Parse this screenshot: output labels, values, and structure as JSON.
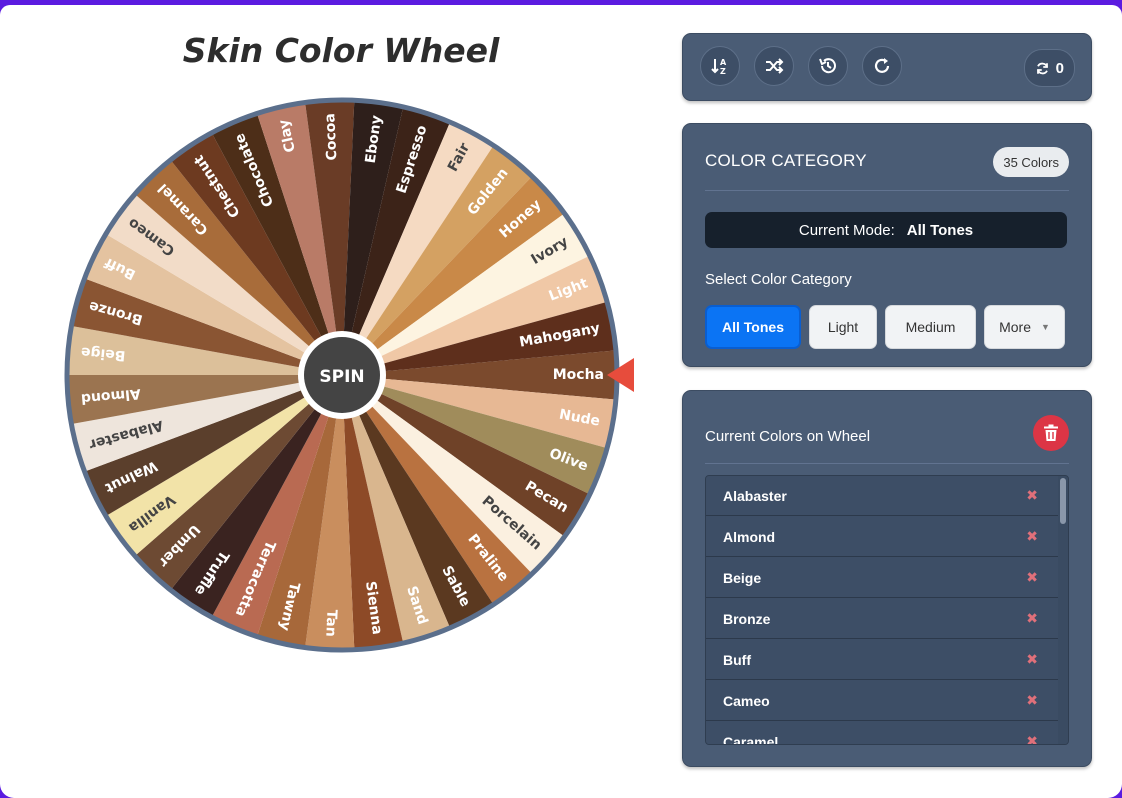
{
  "title": "Skin Color Wheel",
  "spin_label": "SPIN",
  "wheel": {
    "segments": [
      {
        "name": "Mocha",
        "color": "#7b4a2d"
      },
      {
        "name": "Nude",
        "color": "#e7b894"
      },
      {
        "name": "Olive",
        "color": "#a08c5b"
      },
      {
        "name": "Pecan",
        "color": "#6f4228"
      },
      {
        "name": "Porcelain",
        "color": "#fbf0e0"
      },
      {
        "name": "Praline",
        "color": "#b97240"
      },
      {
        "name": "Sable",
        "color": "#5b3920"
      },
      {
        "name": "Sand",
        "color": "#d9b68e"
      },
      {
        "name": "Sienna",
        "color": "#8d4a27"
      },
      {
        "name": "Tan",
        "color": "#c98e5e"
      },
      {
        "name": "Tawny",
        "color": "#a7683a"
      },
      {
        "name": "Terracotta",
        "color": "#b96a52"
      },
      {
        "name": "Truffle",
        "color": "#3a2320"
      },
      {
        "name": "Umber",
        "color": "#6d4a33"
      },
      {
        "name": "Vanilla",
        "color": "#f2e3a8"
      },
      {
        "name": "Walnut",
        "color": "#5b3f2c"
      },
      {
        "name": "Alabaster",
        "color": "#eee5dc"
      },
      {
        "name": "Almond",
        "color": "#9b7450"
      },
      {
        "name": "Beige",
        "color": "#dcc09a"
      },
      {
        "name": "Bronze",
        "color": "#8a5533"
      },
      {
        "name": "Buff",
        "color": "#e4c3a0"
      },
      {
        "name": "Cameo",
        "color": "#f2dcc8"
      },
      {
        "name": "Caramel",
        "color": "#a86c3a"
      },
      {
        "name": "Chestnut",
        "color": "#6d3a20"
      },
      {
        "name": "Chocolate",
        "color": "#4d2e18"
      },
      {
        "name": "Clay",
        "color": "#b97b67"
      },
      {
        "name": "Cocoa",
        "color": "#6a3c26"
      },
      {
        "name": "Ebony",
        "color": "#2e1f1b"
      },
      {
        "name": "Espresso",
        "color": "#3c2318"
      },
      {
        "name": "Fair",
        "color": "#f5dac2"
      },
      {
        "name": "Golden",
        "color": "#d4a162"
      },
      {
        "name": "Honey",
        "color": "#c98948"
      },
      {
        "name": "Ivory",
        "color": "#fdf4e1"
      },
      {
        "name": "Light",
        "color": "#f0c8a6"
      },
      {
        "name": "Mahogany",
        "color": "#5e2f1c"
      }
    ],
    "pointer_color": "#e74c3c",
    "border_color": "#5b6f8c"
  },
  "toolbar": {
    "sort_icon": "sort-az-icon",
    "shuffle_icon": "shuffle-icon",
    "history_icon": "history-icon",
    "redo_icon": "redo-icon",
    "spin_count": "0"
  },
  "category": {
    "title": "COLOR CATEGORY",
    "count_badge": "35 Colors",
    "mode_label": "Current Mode:",
    "mode_value": "All Tones",
    "select_label": "Select Color Category",
    "options": [
      "All Tones",
      "Light",
      "Medium",
      "More"
    ]
  },
  "colors_list": {
    "title": "Current Colors on Wheel",
    "items": [
      "Alabaster",
      "Almond",
      "Beige",
      "Bronze",
      "Buff",
      "Cameo",
      "Caramel"
    ]
  }
}
